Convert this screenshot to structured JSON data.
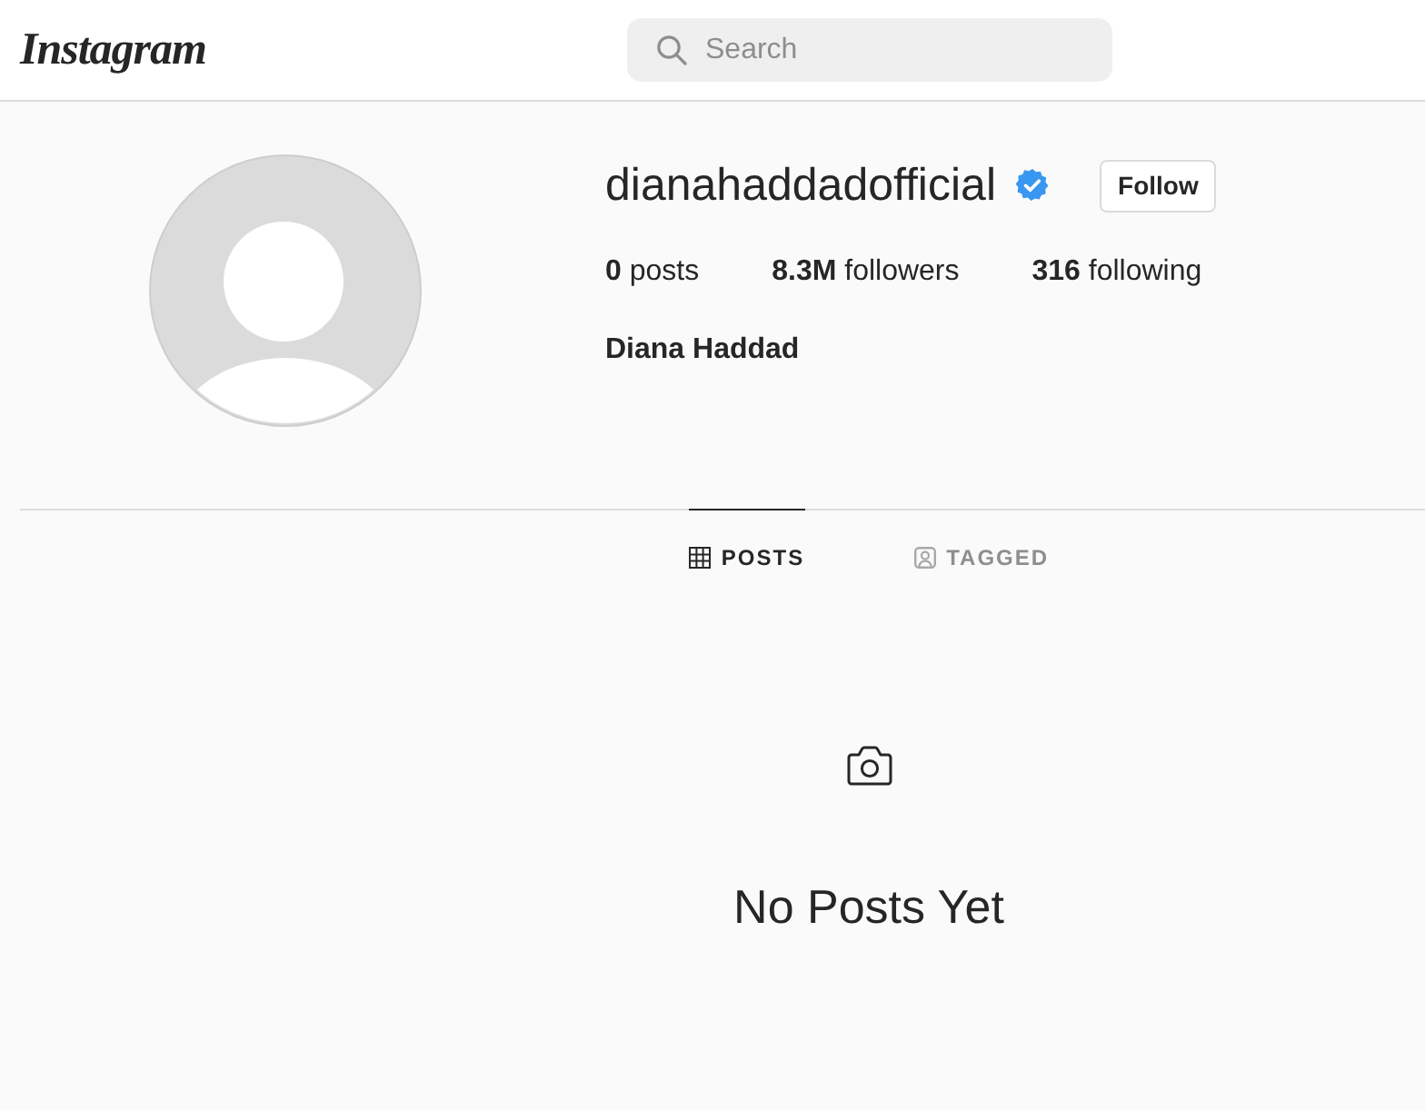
{
  "header": {
    "logo": "Instagram",
    "search": {
      "placeholder": "Search"
    }
  },
  "profile": {
    "username": "dianahaddadofficial",
    "verified": true,
    "follow_button": "Follow",
    "stats": [
      "**0** posts",
      "**8.3M** followers",
      "**316** following"
    ],
    "full_name": "Diana Haddad"
  },
  "tabs": [
    {
      "kind": "grid",
      "label": "POSTS",
      "selected": true
    },
    {
      "kind": "tagged",
      "label": "TAGGED",
      "selected": false
    }
  ],
  "empty_state": {
    "message": "No Posts Yet"
  }
}
